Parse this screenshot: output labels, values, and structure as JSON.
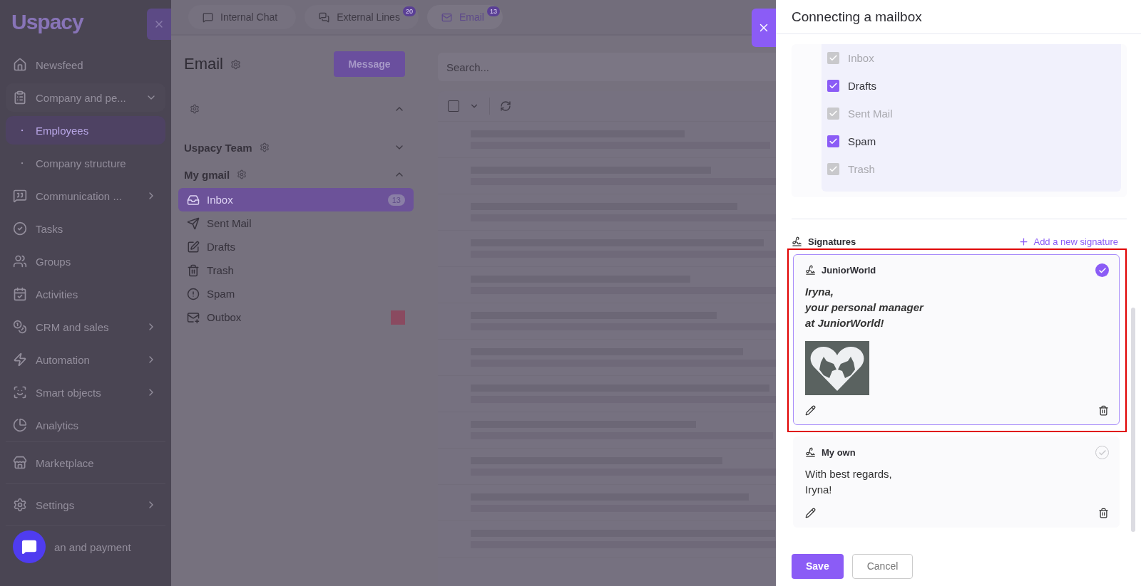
{
  "sidebar": {
    "logo": "Uspacy",
    "groups": [
      {
        "items": [
          {
            "label": "Newsfeed",
            "kind": "item",
            "selected": false
          },
          {
            "label": "Company and pe...",
            "kind": "item",
            "selected": false,
            "expandable": true,
            "expanded": true
          },
          {
            "label": "Employees",
            "kind": "sub",
            "selected": true
          },
          {
            "label": "Company structure",
            "kind": "sub",
            "selected": false
          },
          {
            "label": "Communication ...",
            "kind": "item",
            "selected": false,
            "expandable": true,
            "expanded": false
          },
          {
            "label": "Tasks",
            "kind": "item",
            "selected": false
          },
          {
            "label": "Groups",
            "kind": "item",
            "selected": false
          },
          {
            "label": "Activities",
            "kind": "item",
            "selected": false
          },
          {
            "label": "CRM and sales",
            "kind": "item",
            "selected": false,
            "expandable": true,
            "expanded": false
          },
          {
            "label": "Automation",
            "kind": "item",
            "selected": false,
            "expandable": true,
            "expanded": false
          },
          {
            "label": "Smart objects",
            "kind": "item",
            "selected": false,
            "expandable": true,
            "expanded": false
          },
          {
            "label": "Analytics",
            "kind": "item",
            "selected": false
          }
        ]
      },
      {
        "items": [
          {
            "label": "Marketplace",
            "kind": "item",
            "selected": false
          }
        ]
      },
      {
        "items": [
          {
            "label": "Settings",
            "kind": "item",
            "selected": false,
            "expandable": true,
            "expanded": false
          }
        ]
      },
      {
        "items": [
          {
            "label": "an and payment",
            "kind": "item",
            "selected": false
          }
        ]
      }
    ]
  },
  "tabs": [
    {
      "label": "Internal Chat",
      "selected": false
    },
    {
      "label": "External Lines",
      "badge": "20",
      "selected": false
    },
    {
      "label": "Email",
      "badge": "13",
      "selected": true
    }
  ],
  "email": {
    "title": "Email",
    "message_button": "Message",
    "search": {
      "placeholder": "Search..."
    },
    "select_all": {
      "checked": false
    },
    "accounts": [
      {
        "expanded": true
      },
      {
        "name": "Uspacy Team",
        "expanded": false
      },
      {
        "name": "My gmail",
        "expanded": true,
        "folders": [
          {
            "label": "Inbox",
            "count": "13",
            "selected": true
          },
          {
            "label": "Sent Mail",
            "selected": false
          },
          {
            "label": "Drafts",
            "selected": false
          },
          {
            "label": "Trash",
            "selected": false
          },
          {
            "label": "Spam",
            "selected": false
          },
          {
            "label": "Outbox",
            "selected": false,
            "hidden_badge": true
          }
        ]
      }
    ]
  },
  "drawer": {
    "title": "Connecting a mailbox",
    "folders": [
      {
        "label": "Inbox",
        "checked": true,
        "disabled": true
      },
      {
        "label": "Drafts",
        "checked": true,
        "disabled": false
      },
      {
        "label": "Sent Mail",
        "checked": true,
        "disabled": true
      },
      {
        "label": "Spam",
        "checked": true,
        "disabled": false
      },
      {
        "label": "Trash",
        "checked": true,
        "disabled": true
      }
    ],
    "signatures_label": "Signatures",
    "add_signature": "Add a new signature",
    "signatures": [
      {
        "name": "JuniorWorld",
        "kind": "formatted",
        "selected": true,
        "highlighted": true,
        "image": true,
        "lines": [
          "Iryna,",
          "your personal manager",
          "at JuniorWorld!"
        ]
      },
      {
        "name": "My own",
        "kind": "plain",
        "selected": false,
        "highlighted": false,
        "image": false,
        "lines": [
          "With best regards,",
          "Iryna!"
        ]
      }
    ],
    "buttons": [
      {
        "label": "Save",
        "kind": "primary"
      },
      {
        "label": "Cancel",
        "kind": "secondary"
      }
    ]
  }
}
